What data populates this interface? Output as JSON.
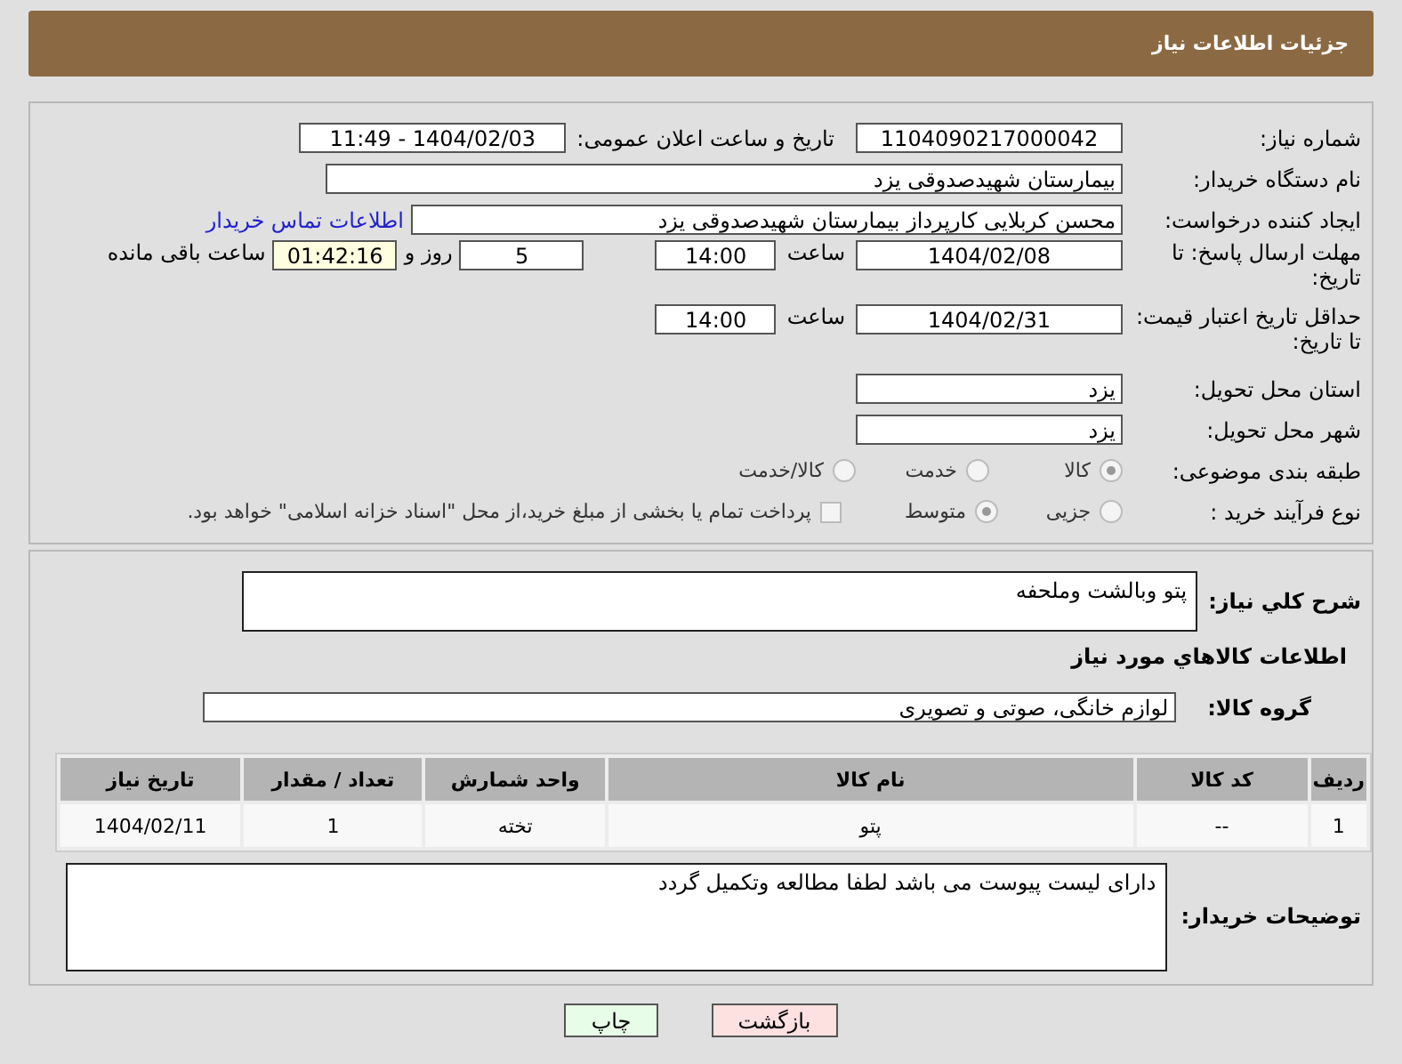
{
  "header": {
    "title": "جزئیات اطلاعات نیاز"
  },
  "details": {
    "need_number": {
      "label": "شماره نیاز:",
      "value": "1104090217000042"
    },
    "announce": {
      "label": "تاریخ و ساعت اعلان عمومی:",
      "value": "1404/02/03 - 11:49"
    },
    "buyer_org": {
      "label": "نام دستگاه خریدار:",
      "value": "بیمارستان شهیدصدوقی یزد"
    },
    "creator": {
      "label": "ایجاد کننده درخواست:",
      "value": "محسن کربلایی کارپرداز بیمارستان شهیدصدوقی یزد",
      "link": "اطلاعات تماس خریدار"
    },
    "deadline": {
      "label": "مهلت ارسال پاسخ: تا تاریخ:",
      "date": "1404/02/08",
      "time_label": "ساعت",
      "time": "14:00",
      "days": "5",
      "days_label": "روز و",
      "remaining": "01:42:16",
      "remaining_label": "ساعت باقی مانده"
    },
    "validity": {
      "label": "حداقل تاریخ اعتبار قیمت: تا تاریخ:",
      "date": "1404/02/31",
      "time_label": "ساعت",
      "time": "14:00"
    },
    "province": {
      "label": "استان محل تحویل:",
      "value": "یزد"
    },
    "city": {
      "label": "شهر محل تحویل:",
      "value": "یزد"
    },
    "category": {
      "label": "طبقه بندی موضوعی:",
      "options": [
        {
          "label": "کالا",
          "selected": true
        },
        {
          "label": "خدمت",
          "selected": false
        },
        {
          "label": "کالا/خدمت",
          "selected": false
        }
      ]
    },
    "process": {
      "label": "نوع فرآیند خرید :",
      "options": [
        {
          "label": "جزیی",
          "selected": false
        },
        {
          "label": "متوسط",
          "selected": true
        }
      ],
      "payment": {
        "checked": false,
        "text": "پرداخت تمام یا بخشی از مبلغ خرید،از محل \"اسناد خزانه اسلامی\" خواهد بود."
      }
    }
  },
  "summary": {
    "label": "شرح كلي نياز:",
    "value": "پتو وبالشت وملحفه"
  },
  "goods_heading": "اطلاعات كالاهاي مورد نياز",
  "goods_group": {
    "label": "گروه کالا:",
    "value": "لوازم خانگی، صوتی و تصویری"
  },
  "table": {
    "columns": [
      "ردیف",
      "کد کالا",
      "نام کالا",
      "واحد شمارش",
      "تعداد / مقدار",
      "تاریخ نیاز"
    ],
    "rows": [
      [
        "1",
        "--",
        "پتو",
        "تخته",
        "1",
        "1404/02/11"
      ]
    ]
  },
  "buyer_notes": {
    "label": "توضیحات خریدار:",
    "value": "دارای لیست پیوست می باشد لطفا مطالعه وتکمیل گردد"
  },
  "buttons": [
    {
      "label": "بازگشت",
      "kind": "back"
    },
    {
      "label": "چاپ",
      "kind": "print"
    }
  ]
}
